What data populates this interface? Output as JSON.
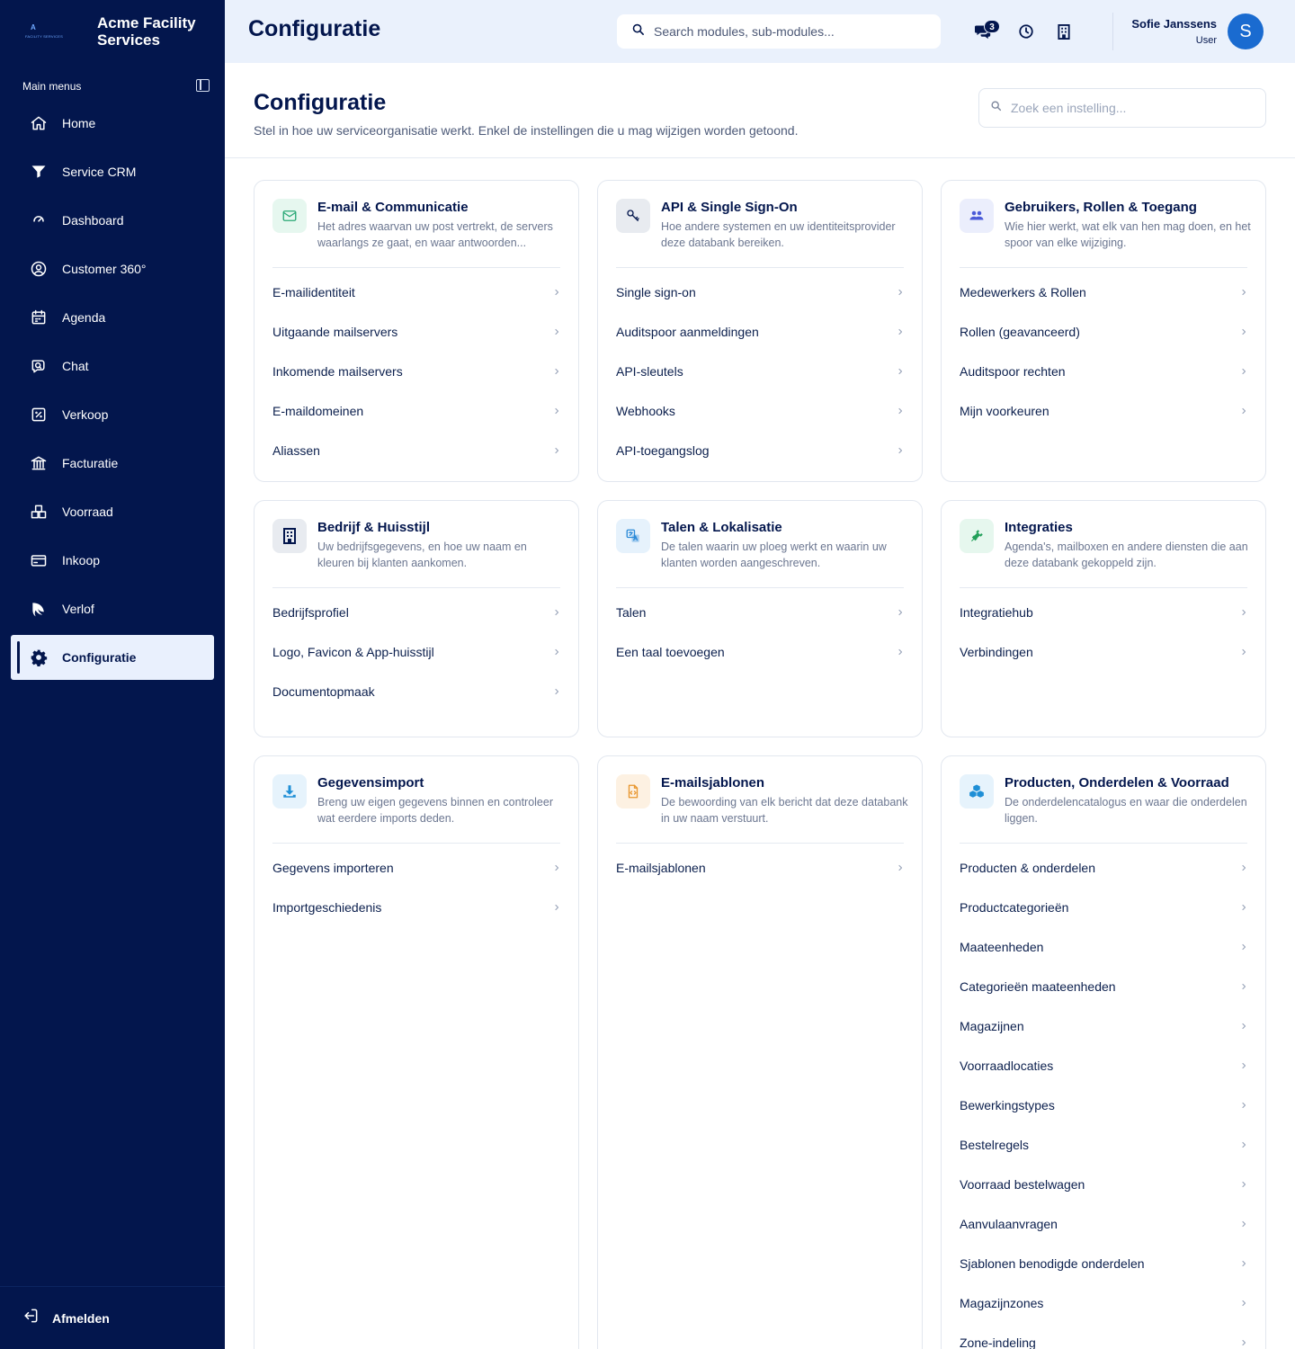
{
  "brand": {
    "logo_letter": "A",
    "logo_sub": "FACILITY SERVICES",
    "name": "Acme Facility Services"
  },
  "sidebar": {
    "section_label": "Main menus",
    "items": [
      {
        "label": "Home",
        "icon": "home-icon"
      },
      {
        "label": "Service CRM",
        "icon": "filter-icon"
      },
      {
        "label": "Dashboard",
        "icon": "gauge-icon"
      },
      {
        "label": "Customer 360°",
        "icon": "user-circle-icon"
      },
      {
        "label": "Agenda",
        "icon": "calendar-icon"
      },
      {
        "label": "Chat",
        "icon": "chat-icon"
      },
      {
        "label": "Verkoop",
        "icon": "percent-icon"
      },
      {
        "label": "Facturatie",
        "icon": "bank-icon"
      },
      {
        "label": "Voorraad",
        "icon": "boxes-icon"
      },
      {
        "label": "Inkoop",
        "icon": "card-icon"
      },
      {
        "label": "Verlof",
        "icon": "leaf-icon"
      },
      {
        "label": "Configuratie",
        "icon": "gear-icon",
        "active": true
      }
    ],
    "logout_label": "Afmelden"
  },
  "topbar": {
    "title": "Configuratie",
    "search_placeholder": "Search modules, sub-modules...",
    "notification_count": "3",
    "user_name": "Sofie Janssens",
    "user_role": "User",
    "avatar_initial": "S"
  },
  "page": {
    "title": "Configuratie",
    "subtitle": "Stel in hoe uw serviceorganisatie werkt. Enkel de instellingen die u mag wijzigen worden getoond.",
    "search_placeholder": "Zoek een instelling..."
  },
  "cards": [
    {
      "title": "E-mail & Communicatie",
      "description": "Het adres waarvan uw post vertrekt, de servers waarlangs ze gaat, en waar antwoorden...",
      "icon": "mail-icon",
      "icon_color": "#2aa876",
      "icon_bg": "#e6f7ef",
      "links": [
        "E-mailidentiteit",
        "Uitgaande mailservers",
        "Inkomende mailservers",
        "E-maildomeinen",
        "Aliassen"
      ]
    },
    {
      "title": "API & Single Sign-On",
      "description": "Hoe andere systemen en uw identiteitsprovider deze databank bereiken.",
      "icon": "key-icon",
      "icon_color": "#03164d",
      "icon_bg": "#e8ebf0",
      "links": [
        "Single sign-on",
        "Auditspoor aanmeldingen",
        "API-sleutels",
        "Webhooks",
        "API-toegangslog"
      ]
    },
    {
      "title": "Gebruikers, Rollen & Toegang",
      "description": "Wie hier werkt, wat elk van hen mag doen, en het spoor van elke wijziging.",
      "icon": "users-icon",
      "icon_color": "#4a5bd8",
      "icon_bg": "#ebeefc",
      "links": [
        "Medewerkers & Rollen",
        "Rollen (geavanceerd)",
        "Auditspoor rechten",
        "Mijn voorkeuren"
      ]
    },
    {
      "title": "Bedrijf & Huisstijl",
      "description": "Uw bedrijfsgegevens, en hoe uw naam en kleuren bij klanten aankomen.",
      "icon": "building-icon",
      "icon_color": "#03164d",
      "icon_bg": "#e8ebf0",
      "links": [
        "Bedrijfsprofiel",
        "Logo, Favicon & App-huisstijl",
        "Documentopmaak"
      ]
    },
    {
      "title": "Talen & Lokalisatie",
      "description": "De talen waarin uw ploeg werkt en waarin uw klanten worden aangeschreven.",
      "icon": "translate-icon",
      "icon_color": "#2b8ad8",
      "icon_bg": "#e6f2fc",
      "links": [
        "Talen",
        "Een taal toevoegen"
      ]
    },
    {
      "title": "Integraties",
      "description": "Agenda's, mailboxen en andere diensten die aan deze databank gekoppeld zijn.",
      "icon": "plug-icon",
      "icon_color": "#22a05a",
      "icon_bg": "#e6f7ee",
      "links": [
        "Integratiehub",
        "Verbindingen"
      ]
    },
    {
      "title": "Gegevensimport",
      "description": "Breng uw eigen gegevens binnen en controleer wat eerdere imports deden.",
      "icon": "download-icon",
      "icon_color": "#1f8fd6",
      "icon_bg": "#e6f3fc",
      "links": [
        "Gegevens importeren",
        "Importgeschiedenis"
      ]
    },
    {
      "title": "E-mailsjablonen",
      "description": "De bewoording van elk bericht dat deze databank in uw naam verstuurt.",
      "icon": "code-file-icon",
      "icon_color": "#e8962e",
      "icon_bg": "#fdf1e2",
      "links": [
        "E-mailsjablonen"
      ]
    },
    {
      "title": "Producten, Onderdelen & Voorraad",
      "description": "De onderdelencatalogus en waar die onderdelen liggen.",
      "icon": "cubes-icon",
      "icon_color": "#1f8fd6",
      "icon_bg": "#e6f3fc",
      "links": [
        "Producten & onderdelen",
        "Productcategorieën",
        "Maateenheden",
        "Categorieën maateenheden",
        "Magazijnen",
        "Voorraadlocaties",
        "Bewerkingstypes",
        "Bestelregels",
        "Voorraad bestelwagen",
        "Aanvulaanvragen",
        "Sjablonen benodigde onderdelen",
        "Magazijnzones",
        "Zone-indeling"
      ]
    }
  ]
}
